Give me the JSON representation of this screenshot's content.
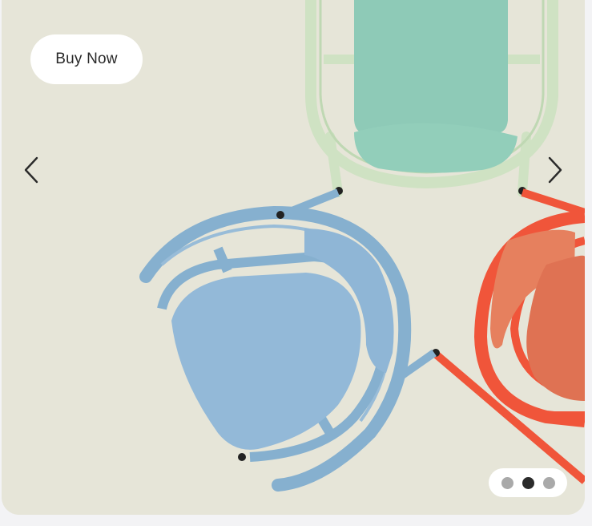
{
  "hero": {
    "cta_label": "Buy Now",
    "image_icon": "chairs-illustration",
    "background_color": "#e6e5d8",
    "prev_icon": "chevron-left-icon",
    "next_icon": "chevron-right-icon"
  },
  "pagination": {
    "total": 3,
    "active_index": 1,
    "active_color": "#2b2b2b",
    "inactive_color": "#a9a9a9"
  },
  "chair_colors": {
    "green": "#cfe2c3",
    "green_cushion": "#8ecab7",
    "blue": "#86b0cf",
    "blue_cushion": "#8fb6d6",
    "orange_frame": "#f0553a",
    "orange_cushion": "#e6805e"
  }
}
